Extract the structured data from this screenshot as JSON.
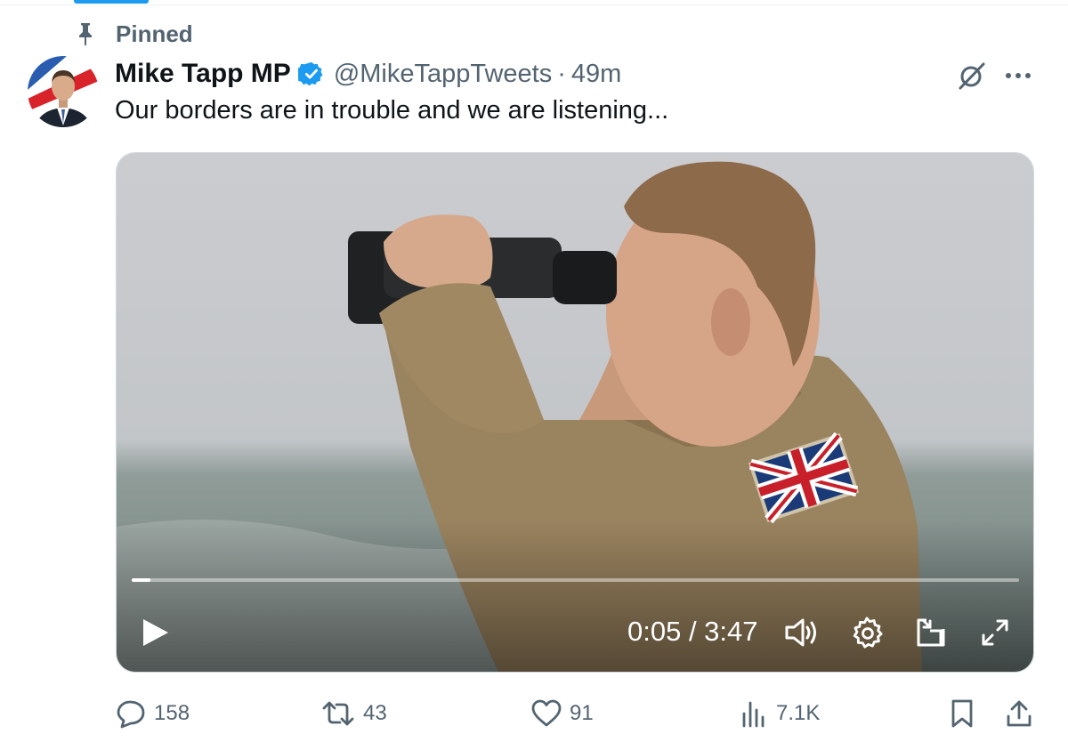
{
  "pinned": {
    "label": "Pinned",
    "icon": "pin-icon"
  },
  "author": {
    "display_name": "Mike Tapp MP",
    "handle": "@MikeTappTweets",
    "separator": "·",
    "timestamp": "49m",
    "verified_icon": "verified-badge-icon"
  },
  "tweet": {
    "text": "Our borders are in trouble and we are listening..."
  },
  "video": {
    "time_readout": "0:05 / 3:47",
    "progress": 0.021
  },
  "actions": {
    "replies": "158",
    "reposts": "43",
    "likes": "91",
    "views": "7.1K"
  },
  "colors": {
    "accent": "#1d9bf0",
    "muted": "#536471",
    "text": "#0f1419"
  }
}
